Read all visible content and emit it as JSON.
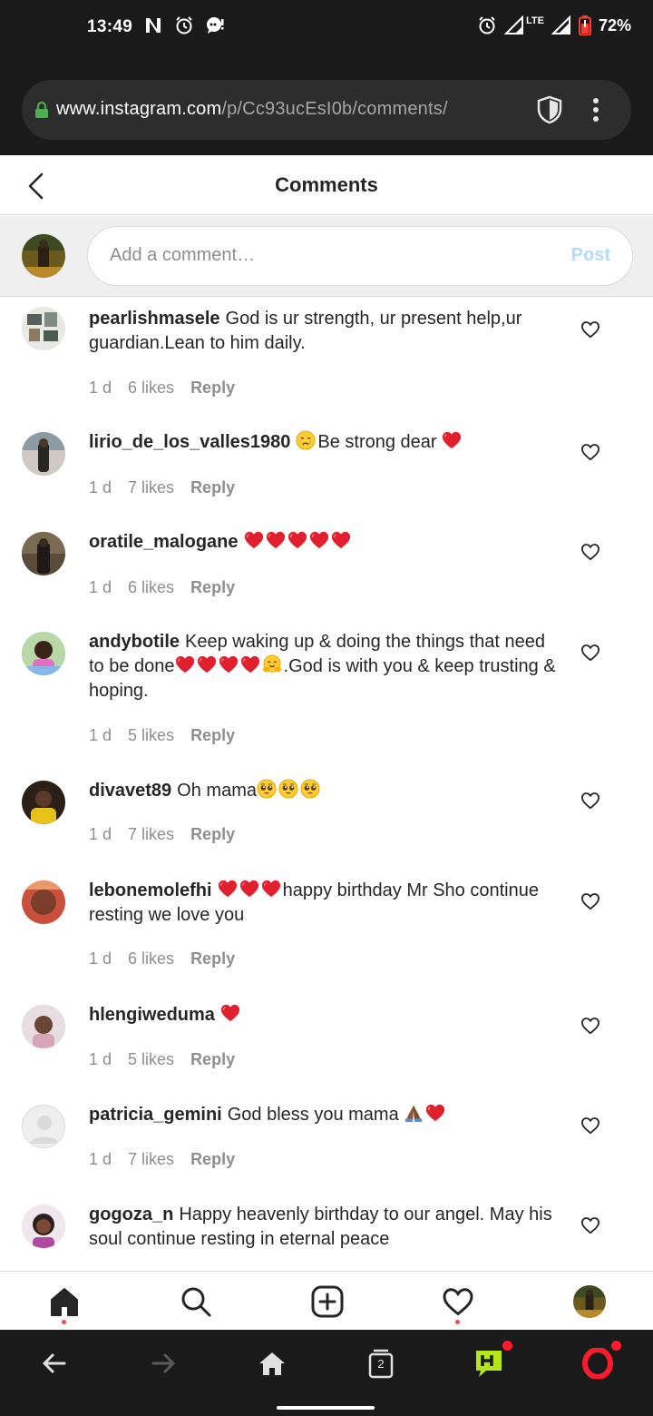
{
  "status_bar": {
    "time": "13:49",
    "battery_percent": "72%",
    "network": "LTE"
  },
  "browser": {
    "url_domain": "www.instagram.com",
    "url_path": "/p/Cc93ucEsI0b/comments/",
    "tab_count": "2"
  },
  "header": {
    "title": "Comments"
  },
  "composer": {
    "placeholder": "Add a comment…",
    "post_label": "Post"
  },
  "comments": [
    {
      "username": "pearlishmasele",
      "text": "God is ur strength, ur present help,ur guardian.Lean to him daily.",
      "time": "1 d",
      "likes": "6 likes",
      "reply": "Reply"
    },
    {
      "username": "lirio_de_los_valles1980",
      "text": "Be strong dear",
      "time": "1 d",
      "likes": "7 likes",
      "reply": "Reply"
    },
    {
      "username": "oratile_malogane",
      "text": "",
      "time": "1 d",
      "likes": "6 likes",
      "reply": "Reply"
    },
    {
      "username": "andybotile",
      "text_a": "Keep waking up & doing the things that need to be done",
      "text_b": ".God is with you & keep trusting & hoping.",
      "time": "1 d",
      "likes": "5 likes",
      "reply": "Reply"
    },
    {
      "username": "divavet89",
      "text": "Oh mama",
      "time": "1 d",
      "likes": "7 likes",
      "reply": "Reply"
    },
    {
      "username": "lebonemolefhi",
      "text": "happy birthday Mr Sho continue resting we love you",
      "time": "1 d",
      "likes": "6 likes",
      "reply": "Reply"
    },
    {
      "username": "hlengiweduma",
      "text": "",
      "time": "1 d",
      "likes": "5 likes",
      "reply": "Reply"
    },
    {
      "username": "patricia_gemini",
      "text": "God bless you mama",
      "time": "1 d",
      "likes": "7 likes",
      "reply": "Reply"
    },
    {
      "username": "gogoza_n",
      "text": "Happy heavenly birthday to our angel. May his soul continue resting in eternal peace"
    }
  ],
  "colors": {
    "post_disabled": "#b3dbff",
    "notification_dot": "#ed4956",
    "heart_emoji": "#e0202e",
    "meta_gray": "#8e8e8e",
    "opera_red": "#ff1b2d"
  },
  "icons": {
    "tabs": [
      "home-icon",
      "search-icon",
      "new-post-icon",
      "activity-heart-icon",
      "profile-avatar"
    ],
    "browser_nav": [
      "back-arrow-icon",
      "forward-arrow-icon",
      "browser-home-icon",
      "tabs-icon",
      "hype-icon",
      "opera-icon"
    ]
  }
}
